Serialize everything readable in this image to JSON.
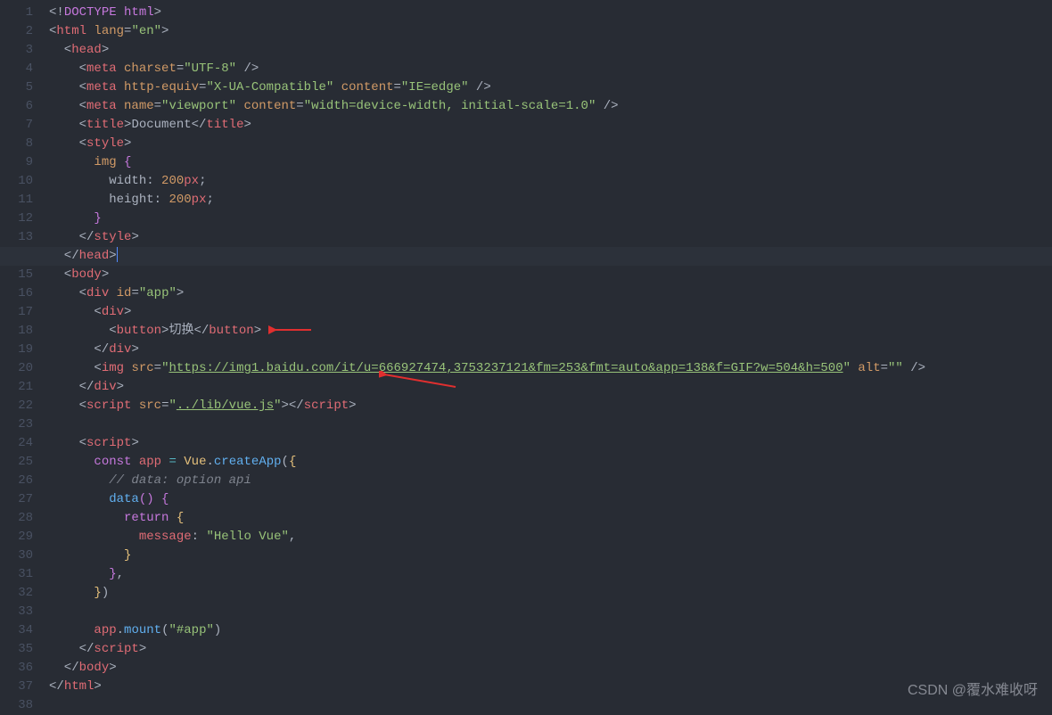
{
  "lineCount": 38,
  "activeLine": 14,
  "watermark": "CSDN @覆水难收呀",
  "code": {
    "l1": {
      "doctype": "DOCTYPE",
      "html": "html"
    },
    "l2": {
      "tag": "html",
      "attr": "lang",
      "val": "\"en\""
    },
    "l3": {
      "tag": "head"
    },
    "l4": {
      "tag": "meta",
      "a1": "charset",
      "v1": "\"UTF-8\""
    },
    "l5": {
      "tag": "meta",
      "a1": "http-equiv",
      "v1": "\"X-UA-Compatible\"",
      "a2": "content",
      "v2": "\"IE=edge\""
    },
    "l6": {
      "tag": "meta",
      "a1": "name",
      "v1": "\"viewport\"",
      "a2": "content",
      "v2": "\"width=device-width, initial-scale=1.0\""
    },
    "l7": {
      "tag": "title",
      "text": "Document"
    },
    "l8": {
      "tag": "style"
    },
    "l9": {
      "sel": "img",
      "br": "{"
    },
    "l10": {
      "prop": "width",
      "num": "200",
      "unit": "px"
    },
    "l11": {
      "prop": "height",
      "num": "200",
      "unit": "px"
    },
    "l12": {
      "br": "}"
    },
    "l13": {
      "tag": "style"
    },
    "l14": {
      "tag": "head"
    },
    "l15": {
      "tag": "body"
    },
    "l16": {
      "tag": "div",
      "a1": "id",
      "v1": "\"app\""
    },
    "l17": {
      "tag": "div"
    },
    "l18": {
      "tag": "button",
      "text": "切换"
    },
    "l19": {
      "tag": "div"
    },
    "l20": {
      "tag": "img",
      "a1": "src",
      "v1": "\"",
      "url": "https://img1.baidu.com/it/u=666927474,3753237121&fm=253&fmt=auto&app=138&f=GIF?w=504&h=500",
      "v1e": "\"",
      "a2": "alt",
      "v2": "\"\""
    },
    "l21": {
      "tag": "div"
    },
    "l22": {
      "tag": "script",
      "a1": "src",
      "v1": "\"",
      "url": "../lib/vue.js",
      "v1e": "\""
    },
    "l24": {
      "tag": "script"
    },
    "l25": {
      "kw": "const",
      "var": "app",
      "cls": "Vue",
      "fn": "createApp"
    },
    "l26": {
      "comment": "// data: option api"
    },
    "l27": {
      "fn": "data"
    },
    "l28": {
      "kw": "return"
    },
    "l29": {
      "prop": "message",
      "val": "\"Hello Vue\""
    },
    "l34": {
      "var": "app",
      "fn": "mount",
      "val": "\"#app\""
    },
    "l35": {
      "tag": "script"
    },
    "l36": {
      "tag": "body"
    },
    "l37": {
      "tag": "html"
    }
  }
}
